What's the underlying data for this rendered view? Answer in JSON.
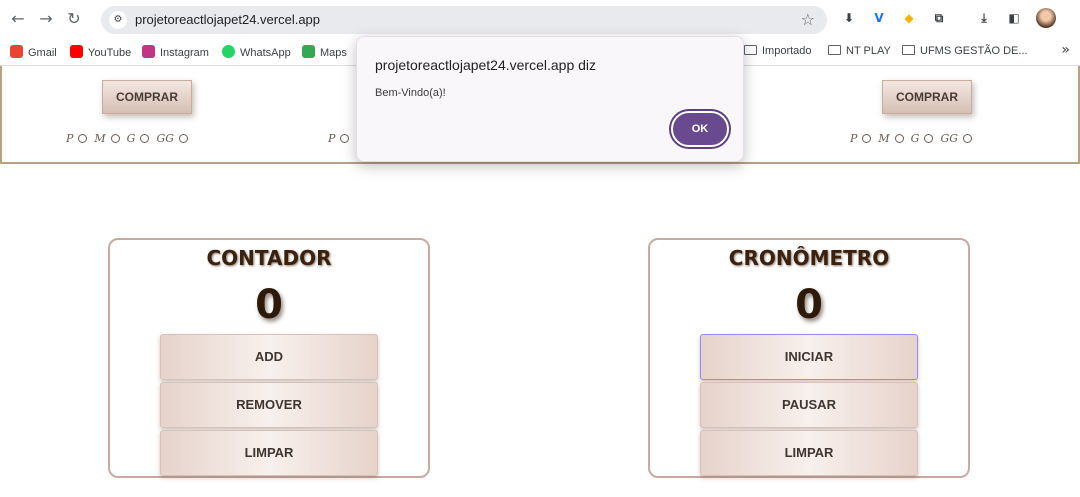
{
  "browser": {
    "url": "projetoreactlojapet24.vercel.app",
    "toolbar_icons": [
      {
        "name": "extension-download-icon",
        "glyph": "⬇",
        "color": "#3c4043"
      },
      {
        "name": "extension-v-icon",
        "glyph": "V",
        "color": "#1a73e8"
      },
      {
        "name": "extension-shield-icon",
        "glyph": "◆",
        "color": "#f4b400"
      },
      {
        "name": "extensions-puzzle-icon",
        "glyph": "⧉",
        "color": "#3c4043"
      },
      {
        "name": "downloads-icon",
        "glyph": "⤓",
        "color": "#3c4043"
      },
      {
        "name": "side-panel-icon",
        "glyph": "◧",
        "color": "#3c4043"
      }
    ]
  },
  "bookmarks": [
    {
      "label": "Gmail",
      "color": "#ea4335"
    },
    {
      "label": "YouTube",
      "color": "#ff0000"
    },
    {
      "label": "Instagram",
      "color": "#c13584"
    },
    {
      "label": "WhatsApp",
      "color": "#25d366"
    },
    {
      "label": "Maps",
      "color": "#34a853"
    },
    {
      "label": "Importado",
      "color": ""
    },
    {
      "label": "NT PLAY",
      "color": ""
    },
    {
      "label": "UFMS GESTÃO DE...",
      "color": ""
    }
  ],
  "products": {
    "buy_label": "COMPRAR",
    "sizes": [
      "P",
      "M",
      "G",
      "GG"
    ]
  },
  "contador": {
    "title": "CONTADOR",
    "value": "0",
    "buttons": [
      "ADD",
      "REMOVER",
      "LIMPAR"
    ]
  },
  "cronometro": {
    "title": "CRONÔMETRO",
    "value": "0",
    "buttons": [
      "INICIAR",
      "PAUSAR",
      "LIMPAR"
    ]
  },
  "dialog": {
    "title": "projetoreactlojapet24.vercel.app diz",
    "message": "Bem-Vindo(a)!",
    "ok_label": "OK",
    "accent": "#6a4a8e"
  }
}
